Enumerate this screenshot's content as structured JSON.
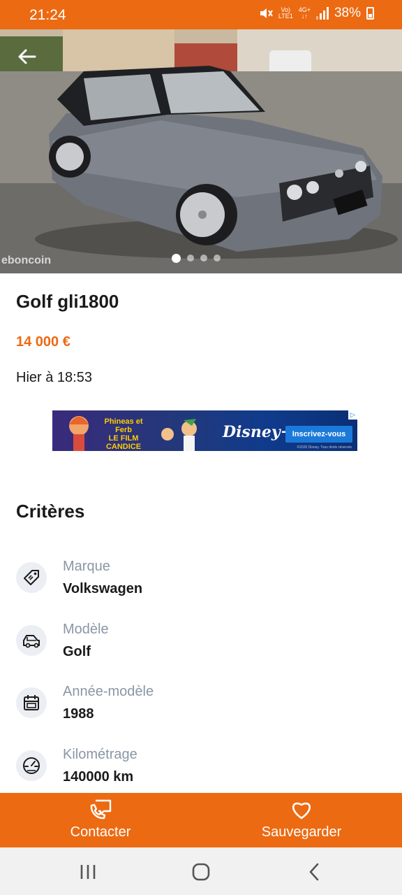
{
  "status_bar": {
    "time": "21:24",
    "volte_top": "Vo)",
    "volte_bottom": "LTE1",
    "network_top": "4G+",
    "network_bottom": "↓↑",
    "battery": "38%"
  },
  "gallery": {
    "watermark": "eboncoin",
    "image_count": 4,
    "active_index": 0
  },
  "listing": {
    "title": "Golf gli1800",
    "price": "14 000 €",
    "date": "Hier à 18:53"
  },
  "ad": {
    "title_line1": "Phineas et Ferb",
    "title_line2": "LE FILM",
    "title_line3": "CANDICE",
    "brand": "Disney+",
    "cta": "Inscrivez-vous",
    "fine_print": "©2020 Disney. Tous droits réservés"
  },
  "criteria": {
    "heading": "Critères",
    "items": [
      {
        "label": "Marque",
        "value": "Volkswagen",
        "icon": "tag-icon"
      },
      {
        "label": "Modèle",
        "value": "Golf",
        "icon": "car-icon"
      },
      {
        "label": "Année-modèle",
        "value": "1988",
        "icon": "calendar-icon"
      },
      {
        "label": "Kilométrage",
        "value": "140000 km",
        "icon": "speedometer-icon"
      }
    ]
  },
  "actions": {
    "contact": "Contacter",
    "save": "Sauvegarder"
  },
  "colors": {
    "accent": "#ec6a12",
    "label_grey": "#8a96a6",
    "icon_bg": "#ebeef2"
  }
}
